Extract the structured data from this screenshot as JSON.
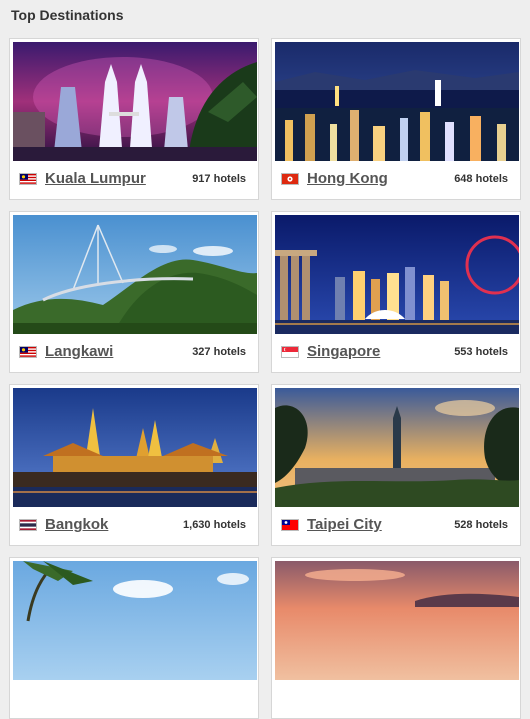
{
  "section": {
    "title": "Top Destinations"
  },
  "destinations": [
    {
      "city": "Kuala Lumpur",
      "hotels": "917 hotels",
      "flag_icon": "malaysia-flag-icon"
    },
    {
      "city": "Hong Kong",
      "hotels": "648 hotels",
      "flag_icon": "hong-kong-flag-icon"
    },
    {
      "city": "Langkawi",
      "hotels": "327 hotels",
      "flag_icon": "malaysia-flag-icon"
    },
    {
      "city": "Singapore",
      "hotels": "553 hotels",
      "flag_icon": "singapore-flag-icon"
    },
    {
      "city": "Bangkok",
      "hotels": "1,630 hotels",
      "flag_icon": "thailand-flag-icon"
    },
    {
      "city": "Taipei City",
      "hotels": "528 hotels",
      "flag_icon": "taiwan-flag-icon"
    }
  ],
  "colors": {
    "link": "#555555",
    "card_border": "#d6d6d6",
    "background": "#eeeeee"
  }
}
